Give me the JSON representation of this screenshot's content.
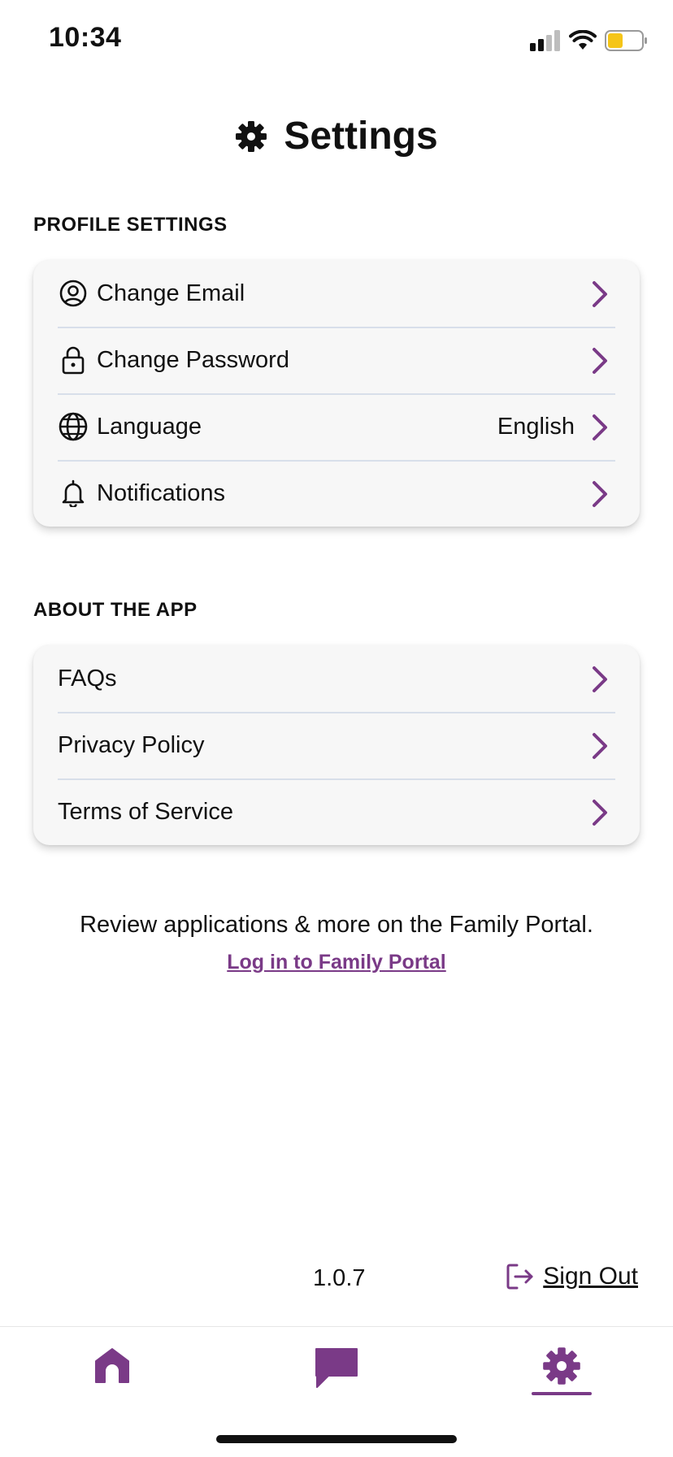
{
  "status_bar": {
    "time": "10:34",
    "battery_color": "#f5c518"
  },
  "header": {
    "title": "Settings",
    "icon": "gear-icon"
  },
  "profile_section": {
    "label": "PROFILE SETTINGS",
    "items": [
      {
        "label": "Change Email",
        "icon": "user-circle-icon",
        "value": ""
      },
      {
        "label": "Change Password",
        "icon": "lock-icon",
        "value": ""
      },
      {
        "label": "Language",
        "icon": "globe-icon",
        "value": "English"
      },
      {
        "label": "Notifications",
        "icon": "bell-icon",
        "value": ""
      }
    ]
  },
  "about_section": {
    "label": "ABOUT THE APP",
    "items": [
      {
        "label": "FAQs"
      },
      {
        "label": "Privacy Policy"
      },
      {
        "label": "Terms of Service"
      }
    ]
  },
  "promo": {
    "text": "Review applications & more on the Family Portal.",
    "link_label": "Log in to Family Portal"
  },
  "footer": {
    "version": "1.0.7",
    "sign_out_label": "Sign Out"
  },
  "tab_bar": {
    "tabs": [
      {
        "icon": "home-icon",
        "active": false
      },
      {
        "icon": "chat-bubble-icon",
        "active": false
      },
      {
        "icon": "gear-icon",
        "active": true
      }
    ]
  },
  "colors": {
    "accent": "#7a3a87",
    "card_bg": "#f7f7f7",
    "divider": "#d8dfea",
    "text": "#111111"
  }
}
